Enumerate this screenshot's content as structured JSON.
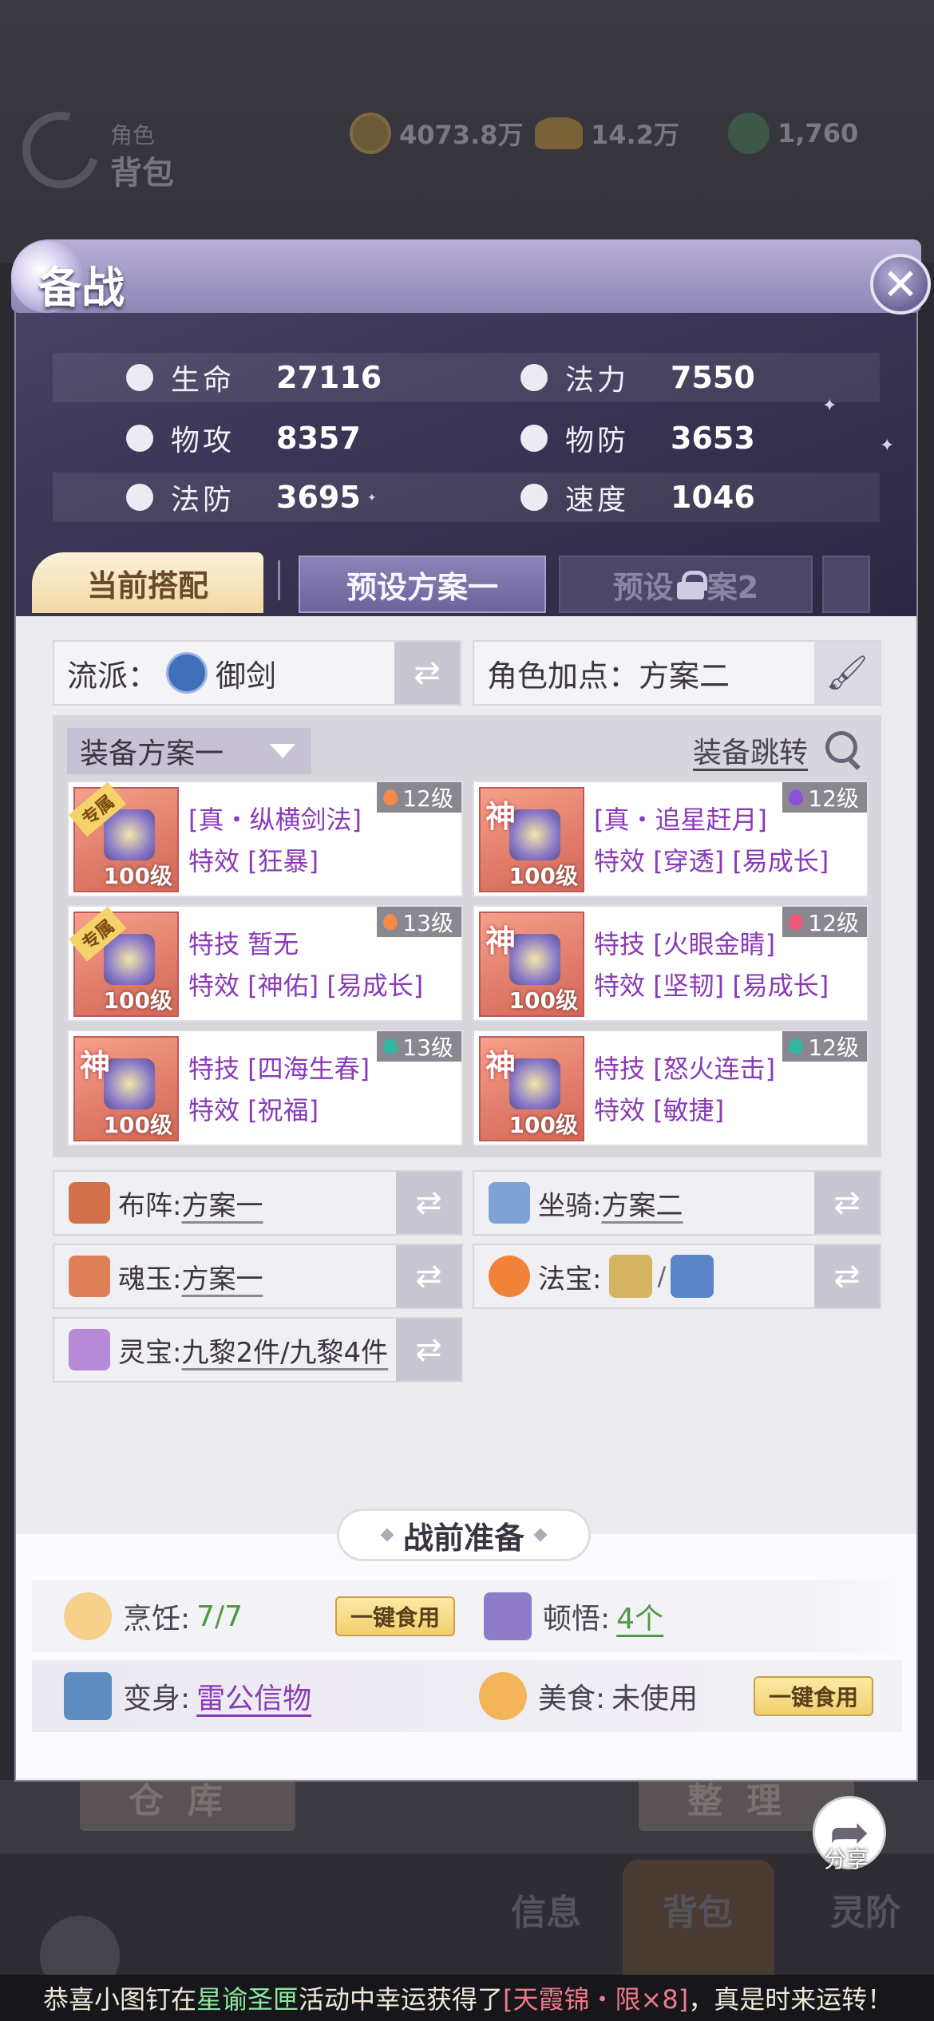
{
  "background": {
    "title_small": "角色",
    "title_big": "背包",
    "resources": [
      "4073.8万",
      "14.2万",
      "1,760"
    ],
    "buttons": [
      "仓库",
      "整理"
    ],
    "nav": [
      "信息",
      "背包",
      "灵阶"
    ]
  },
  "modal": {
    "title": "备战",
    "close_icon": "close-icon",
    "stats": [
      {
        "label": "生命",
        "value": "27116",
        "icon": "heart-icon"
      },
      {
        "label": "法力",
        "value": "7550",
        "icon": "swirl-icon"
      },
      {
        "label": "物攻",
        "value": "8357",
        "icon": "sword-icon"
      },
      {
        "label": "物防",
        "value": "3653",
        "icon": "shield-icon"
      },
      {
        "label": "法防",
        "value": "3695",
        "icon": "magic-shield-icon"
      },
      {
        "label": "速度",
        "value": "1046",
        "icon": "boot-icon"
      }
    ],
    "tabs": {
      "current": "当前搭配",
      "preset1": "预设方案一",
      "preset2_pre": "预设",
      "preset2_post": "案2"
    },
    "faction": {
      "label": "流派：",
      "value": "御剑"
    },
    "points": {
      "label": "角色加点：",
      "value": "方案二"
    },
    "equip_plan": "装备方案一",
    "equip_jump": "装备跳转",
    "equipment": [
      {
        "tag": "专属",
        "level": "100级",
        "badge": "12级",
        "gem": "#f28b4a",
        "line1": "[真・纵横剑法]",
        "line2": "特效 [狂暴]"
      },
      {
        "tag": "神",
        "level": "100级",
        "badge": "12级",
        "gem": "#8a52d8",
        "line1": "[真・追星赶月]",
        "line2": "特效 [穿透] [易成长]"
      },
      {
        "tag": "专属",
        "level": "100级",
        "badge": "13级",
        "gem": "#f28b4a",
        "line1": "特技 暂无",
        "line2": "特效 [神佑] [易成长]"
      },
      {
        "tag": "神",
        "level": "100级",
        "badge": "12级",
        "gem": "#f05a78",
        "line1": "特技 [火眼金睛]",
        "line2": "特效 [坚韧] [易成长]"
      },
      {
        "tag": "神",
        "level": "100级",
        "badge": "13级",
        "gem": "#34b6a4",
        "line1": "特技 [四海生春]",
        "line2": "特效 [祝福]"
      },
      {
        "tag": "神",
        "level": "100级",
        "badge": "12级",
        "gem": "#34b6a4",
        "line1": "特技 [怒火连击]",
        "line2": "特效 [敏捷]"
      }
    ],
    "options": {
      "formation": {
        "label": "布阵:",
        "value": "方案一"
      },
      "mount": {
        "label": "坐骑:",
        "value": "方案二"
      },
      "soul_jade": {
        "label": "魂玉:",
        "value": "方案一"
      },
      "treasure": {
        "label": "法宝:",
        "value": "/"
      },
      "spirit": {
        "label": "灵宝:",
        "value": "九黎2件/九黎4件"
      }
    },
    "prep": {
      "title": "战前准备",
      "cook": {
        "label": "烹饪:",
        "value": "7/7",
        "button": "一键食用"
      },
      "insight": {
        "label": "顿悟:",
        "value": "4个"
      },
      "transform": {
        "label": "变身:",
        "value": "雷公信物"
      },
      "food": {
        "label": "美食:",
        "value": "未使用",
        "button": "一键食用"
      }
    },
    "share": "分享"
  },
  "ticker": {
    "p1": "恭喜小图钉在",
    "p2": "星谕圣匣",
    "p3": "活动中幸运获得了",
    "p4": "[天霞锦・限×8]",
    "p5": "，真是时来运转！"
  }
}
